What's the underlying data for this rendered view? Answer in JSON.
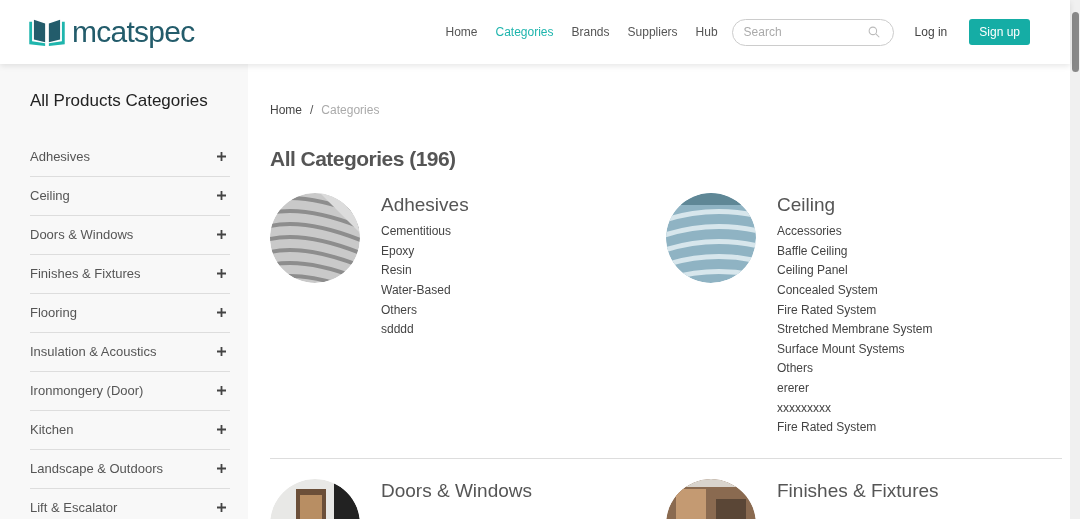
{
  "logo": {
    "text": "mcatspec"
  },
  "nav": [
    {
      "label": "Home",
      "selected": false
    },
    {
      "label": "Categories",
      "selected": true
    },
    {
      "label": "Brands",
      "selected": false
    },
    {
      "label": "Suppliers",
      "selected": false
    },
    {
      "label": "Hub",
      "selected": false
    }
  ],
  "search": {
    "placeholder": "Search"
  },
  "login": "Log in",
  "signup": "Sign up",
  "sidebar": {
    "title": "All Products Categories",
    "items": [
      {
        "label": "Adhesives",
        "expanded": false
      },
      {
        "label": "Ceiling",
        "expanded": false
      },
      {
        "label": "Doors & Windows",
        "expanded": false
      },
      {
        "label": "Finishes & Fixtures",
        "expanded": false
      },
      {
        "label": "Flooring",
        "expanded": false
      },
      {
        "label": "Insulation & Acoustics",
        "expanded": false
      },
      {
        "label": "Ironmongery (Door)",
        "expanded": false
      },
      {
        "label": "Kitchen",
        "expanded": false
      },
      {
        "label": "Landscape & Outdoors",
        "expanded": false
      },
      {
        "label": "Lift & Escalator",
        "expanded": false
      }
    ]
  },
  "breadcrumb": {
    "separator": "/",
    "items": [
      {
        "label": "Home",
        "current": false
      },
      {
        "label": "Categories",
        "current": true
      }
    ]
  },
  "heading": "All Categories (196)",
  "categories": [
    {
      "title": "Adhesives",
      "items": [
        "Cementitious",
        "Epoxy",
        "Resin",
        "Water-Based",
        "Others",
        "sdddd"
      ]
    },
    {
      "title": "Ceiling",
      "items": [
        "Accessories",
        "Baffle Ceiling",
        "Ceiling Panel",
        "Concealed System",
        "Fire Rated System",
        "Stretched Membrane System",
        "Surface Mount Systems",
        "Others",
        "ererer",
        "xxxxxxxxx",
        "Fire Rated System"
      ]
    },
    {
      "title": "Doors & Windows"
    },
    {
      "title": "Finishes & Fixtures"
    }
  ]
}
